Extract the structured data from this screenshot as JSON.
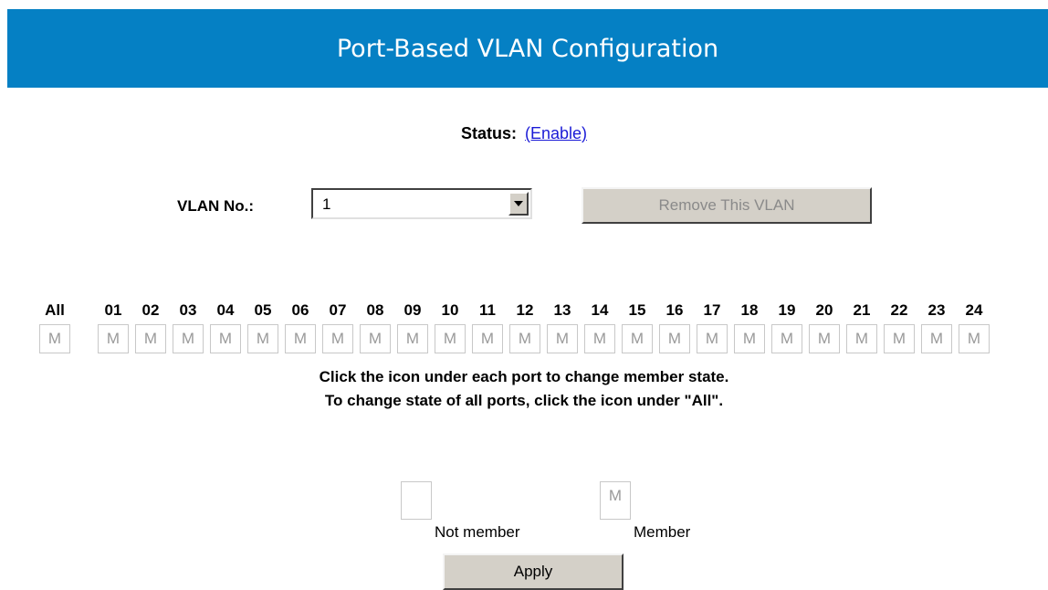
{
  "header": {
    "title": "Port-Based VLAN Configuration"
  },
  "status": {
    "label": "Status:",
    "link": "(Enable)"
  },
  "vlan": {
    "label": "VLAN No.:",
    "selected": "1",
    "remove_label": "Remove This VLAN"
  },
  "ports": {
    "all_label": "All",
    "all_state": "M",
    "labels": [
      "01",
      "02",
      "03",
      "04",
      "05",
      "06",
      "07",
      "08",
      "09",
      "10",
      "11",
      "12",
      "13",
      "14",
      "15",
      "16",
      "17",
      "18",
      "19",
      "20",
      "21",
      "22",
      "23",
      "24"
    ],
    "states": [
      "M",
      "M",
      "M",
      "M",
      "M",
      "M",
      "M",
      "M",
      "M",
      "M",
      "M",
      "M",
      "M",
      "M",
      "M",
      "M",
      "M",
      "M",
      "M",
      "M",
      "M",
      "M",
      "M",
      "M"
    ]
  },
  "help": {
    "line1": "Click the icon under each port to change member state.",
    "line2": "To change state of all ports, click the icon under \"All\"."
  },
  "legend": {
    "not_member_icon": "",
    "not_member_label": "Not member",
    "member_icon": "M",
    "member_label": "Member"
  },
  "apply_label": "Apply",
  "colors": {
    "header_bg": "#0580c4",
    "link": "#1a1ad6",
    "button_face": "#d4d0c8"
  }
}
